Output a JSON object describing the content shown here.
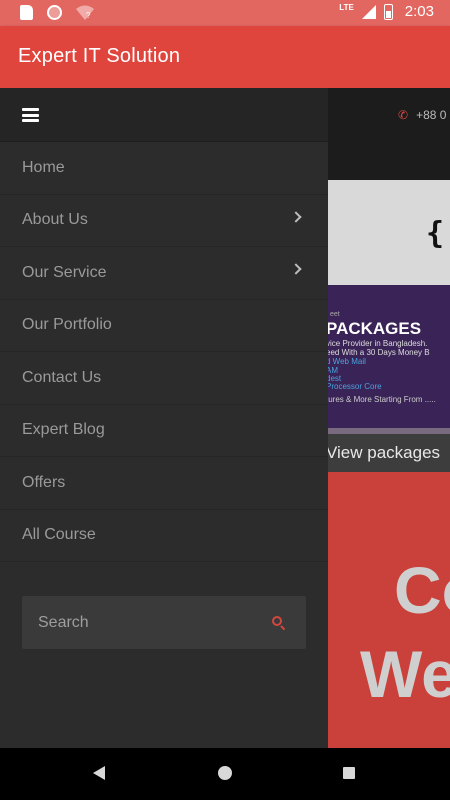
{
  "status_bar": {
    "network": "LTE",
    "time": "2:03"
  },
  "app_bar": {
    "title": "Expert IT Solution"
  },
  "background_page": {
    "phone": "+88 0",
    "logo": "{",
    "promo_small": "eet",
    "promo_title": "PACKAGES",
    "promo_line1": "vice Provider in Bangladesh.",
    "promo_line2": "eed With a 30 Days Money B",
    "promo_line3": "d Web Mail",
    "promo_line4": "AM",
    "promo_line5": "dest",
    "promo_line6": "Processor Core",
    "promo_line7": "tures & More Starting From .....",
    "view_packages": "View packages",
    "hero_line1": "Co",
    "hero_line2": "We"
  },
  "drawer": {
    "menu": [
      {
        "label": "Home",
        "has_submenu": false
      },
      {
        "label": "About Us",
        "has_submenu": true
      },
      {
        "label": "Our Service",
        "has_submenu": true
      },
      {
        "label": "Our Portfolio",
        "has_submenu": false
      },
      {
        "label": "Contact Us",
        "has_submenu": false
      },
      {
        "label": "Expert Blog",
        "has_submenu": false
      },
      {
        "label": "Offers",
        "has_submenu": false
      },
      {
        "label": "All Course",
        "has_submenu": false
      }
    ],
    "search": {
      "placeholder": "Search",
      "value": ""
    }
  },
  "colors": {
    "app_bar": "#e0453d",
    "status_bar": "#e36761",
    "drawer_bg": "#2c2c2c",
    "accent": "#d3473f"
  },
  "icons": {
    "menu": "hamburger-icon",
    "submenu": "chevron-right-icon",
    "search": "search-icon"
  }
}
